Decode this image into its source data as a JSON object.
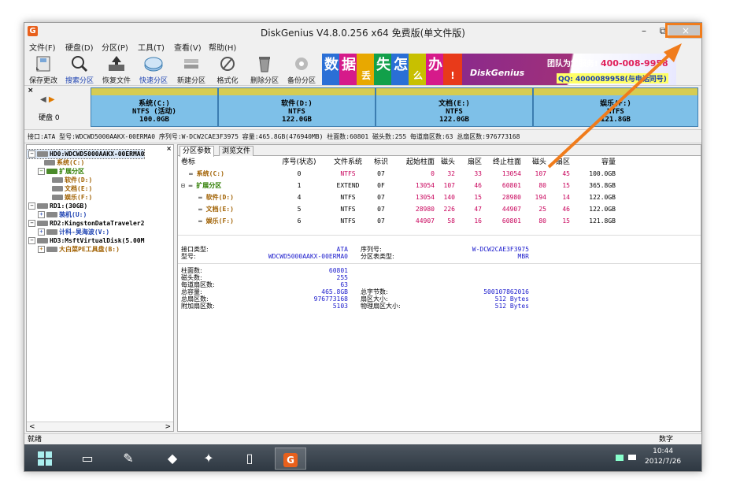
{
  "window": {
    "title": "DiskGenius V4.8.0.256 x64 免费版(单文件版)",
    "min": "–",
    "max": "⧉",
    "close": "×"
  },
  "menu": [
    "文件(F)",
    "硬盘(D)",
    "分区(P)",
    "工具(T)",
    "查看(V)",
    "帮助(H)"
  ],
  "toolbar": [
    {
      "label": "保存更改",
      "icon": "save-icon",
      "blue": false
    },
    {
      "label": "搜索分区",
      "icon": "search-icon",
      "blue": true
    },
    {
      "label": "恢复文件",
      "icon": "recover-icon",
      "blue": false
    },
    {
      "label": "快速分区",
      "icon": "quick-partition-icon",
      "blue": true
    },
    {
      "label": "新建分区",
      "icon": "new-partition-icon",
      "blue": false
    },
    {
      "label": "格式化",
      "icon": "format-icon",
      "blue": false
    },
    {
      "label": "删除分区",
      "icon": "delete-icon",
      "blue": false
    },
    {
      "label": "备份分区",
      "icon": "backup-icon",
      "blue": false
    }
  ],
  "banner": {
    "chars": [
      "数",
      "据",
      "丢",
      "失",
      "怎",
      "么",
      "办",
      "!"
    ],
    "brand": "DiskGenius",
    "team": "团队为您服务!",
    "phone": "400-008-9958",
    "qq": "QQ: 4000089958(与电话同号)"
  },
  "diskbar": {
    "disk_label": "硬盘 0",
    "partitions": [
      {
        "name": "系统(C:)",
        "fs": "NTFS (活动)",
        "size": "100.0GB"
      },
      {
        "name": "软件(D:)",
        "fs": "NTFS",
        "size": "122.0GB"
      },
      {
        "name": "文档(E:)",
        "fs": "NTFS",
        "size": "122.0GB"
      },
      {
        "name": "娱乐(F:)",
        "fs": "NTFS",
        "size": "121.8GB"
      }
    ]
  },
  "infoline": "接口:ATA  型号:WDCWD5000AAKX-00ERMA0  序列号:W-DCW2CAE3F3975  容量:465.8GB(476940MB)  柱面数:60801  磁头数:255  每道扇区数:63  总扇区数:976773168",
  "tree": [
    {
      "text": "HD0:WDCWD5000AAKX-00ERMA0",
      "indent": 2,
      "box": "−",
      "kind": "hd",
      "color": "#000",
      "selected": true
    },
    {
      "text": "系统(C:)",
      "indent": 22,
      "box": "",
      "kind": "part",
      "color": "#a06000"
    },
    {
      "text": "扩展分区",
      "indent": 14,
      "box": "−",
      "kind": "ext",
      "color": "#2e7d00"
    },
    {
      "text": "软件(D:)",
      "indent": 32,
      "box": "",
      "kind": "part",
      "color": "#a06000"
    },
    {
      "text": "文档(E:)",
      "indent": 32,
      "box": "",
      "kind": "part",
      "color": "#a06000"
    },
    {
      "text": "娱乐(F:)",
      "indent": 32,
      "box": "",
      "kind": "part",
      "color": "#a06000"
    },
    {
      "text": "RD1:(30GB)",
      "indent": 2,
      "box": "−",
      "kind": "hd",
      "color": "#000"
    },
    {
      "text": "装机(U:)",
      "indent": 14,
      "box": "+",
      "kind": "part",
      "color": "#1a3fb0"
    },
    {
      "text": "RD2:KingstonDataTraveler2",
      "indent": 2,
      "box": "−",
      "kind": "hd",
      "color": "#000"
    },
    {
      "text": "计科-吴海波(V:)",
      "indent": 14,
      "box": "+",
      "kind": "part",
      "color": "#1a3fb0"
    },
    {
      "text": "HD3:MsftVirtualDisk(5.00M",
      "indent": 2,
      "box": "−",
      "kind": "hd",
      "color": "#000"
    },
    {
      "text": "大白菜PE工具盘(B:)",
      "indent": 14,
      "box": "+",
      "kind": "part",
      "color": "#a06000"
    }
  ],
  "tree_close": "×",
  "scroll": {
    "left": "<",
    "right": ">"
  },
  "tabs": [
    "分区参数",
    "浏览文件"
  ],
  "table": {
    "headers": [
      "卷标",
      "序号(状态)",
      "文件系统",
      "标识",
      "起始柱面",
      "磁头",
      "扇区",
      "终止柱面",
      "磁头",
      "扇区",
      "容量"
    ],
    "rows": [
      {
        "label": "系统(C:)",
        "indent": 10,
        "kind": "part",
        "cells": [
          "0",
          "NTFS",
          "07",
          "0",
          "32",
          "33",
          "13054",
          "107",
          "45",
          "100.0GB"
        ],
        "fs_red": true,
        "label_color": "#a06000"
      },
      {
        "label": "扩展分区",
        "indent": 0,
        "kind": "ext",
        "cells": [
          "1",
          "EXTEND",
          "0F",
          "13054",
          "107",
          "46",
          "60801",
          "80",
          "15",
          "365.8GB"
        ],
        "fs_red": false,
        "label_color": "#2e7d00"
      },
      {
        "label": "软件(D:)",
        "indent": 22,
        "kind": "part",
        "cells": [
          "4",
          "NTFS",
          "07",
          "13054",
          "140",
          "15",
          "28980",
          "194",
          "14",
          "122.0GB"
        ],
        "fs_red": false,
        "label_color": "#a06000"
      },
      {
        "label": "文档(E:)",
        "indent": 22,
        "kind": "part",
        "cells": [
          "5",
          "NTFS",
          "07",
          "28980",
          "226",
          "47",
          "44907",
          "25",
          "46",
          "122.0GB"
        ],
        "fs_red": false,
        "label_color": "#a06000"
      },
      {
        "label": "娱乐(F:)",
        "indent": 22,
        "kind": "part",
        "cells": [
          "6",
          "NTFS",
          "07",
          "44907",
          "58",
          "16",
          "60801",
          "80",
          "15",
          "121.8GB"
        ],
        "fs_red": false,
        "label_color": "#a06000"
      }
    ]
  },
  "details": {
    "block1": [
      {
        "k": "接口类型:",
        "v": "ATA",
        "k2": "序列号:",
        "v2": "W-DCW2CAE3F3975"
      },
      {
        "k": "型号:",
        "v": "WDCWD5000AAKX-00ERMA0",
        "k2": "分区表类型:",
        "v2": "MBR"
      }
    ],
    "block2": [
      {
        "k": "柱面数:",
        "v": "60801",
        "k2": "",
        "v2": ""
      },
      {
        "k": "磁头数:",
        "v": "255",
        "k2": "",
        "v2": ""
      },
      {
        "k": "每道扇区数:",
        "v": "63",
        "k2": "",
        "v2": ""
      },
      {
        "k": "总容量:",
        "v": "465.8GB",
        "k2": "总字节数:",
        "v2": "500107862016"
      },
      {
        "k": "总扇区数:",
        "v": "976773168",
        "k2": "扇区大小:",
        "v2": "512 Bytes"
      },
      {
        "k": "附加扇区数:",
        "v": "5103",
        "k2": "物理扇区大小:",
        "v2": "512 Bytes"
      }
    ]
  },
  "status": {
    "left": "就绪",
    "right": "数字"
  },
  "taskbar": {
    "time": "10:44",
    "date": "2012/7/26"
  },
  "colors": {
    "annotation": "#f07c1c",
    "partition_fill": "#7ec0e8",
    "partition_top": "#d6cc52"
  }
}
